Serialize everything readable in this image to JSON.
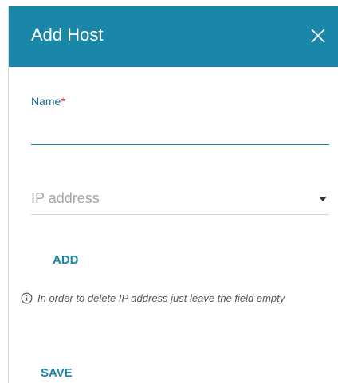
{
  "dialog": {
    "title": "Add Host",
    "close_icon": "close-icon"
  },
  "form": {
    "name_label": "Name",
    "required_marker": "*",
    "name_value": "",
    "ip_placeholder": "IP address",
    "add_label": "ADD",
    "info_text": "In order to delete IP address just leave the field empty",
    "save_label": "SAVE"
  },
  "colors": {
    "accent": "#1b87a8",
    "required": "#e03232"
  }
}
